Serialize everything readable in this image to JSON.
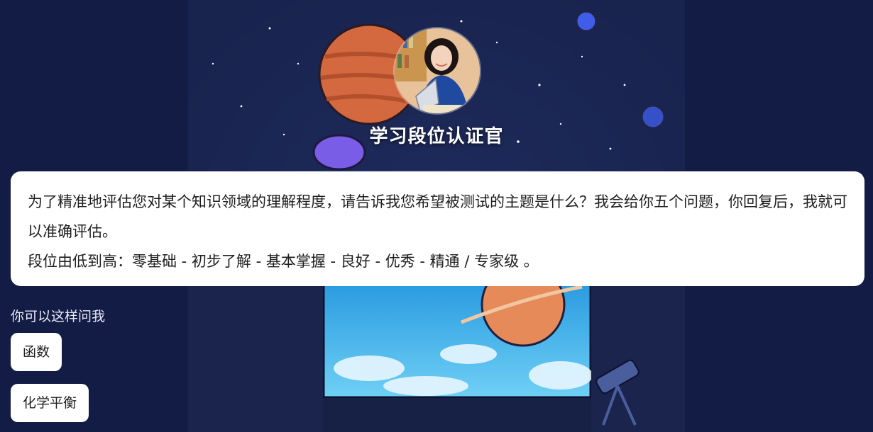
{
  "header": {
    "bot_title": "学习段位认证官",
    "avatar_icon": "avatar-woman-studying-icon"
  },
  "intro": {
    "line1": "为了精准地评估您对某个知识领域的理解程度，请告诉我您希望被测试的主题是什么？我会给你五个问题，你回复后，我就可以准确评估。",
    "line2": "段位由低到高：零基础 - 初步了解 - 基本掌握 - 良好 - 优秀 - 精通 / 专家级 。"
  },
  "suggestions": {
    "label": "你可以这样问我",
    "items": [
      "函数",
      "化学平衡"
    ]
  },
  "colors": {
    "background": "#131c45",
    "bubble": "#ffffff",
    "text": "#1f1f1f"
  }
}
